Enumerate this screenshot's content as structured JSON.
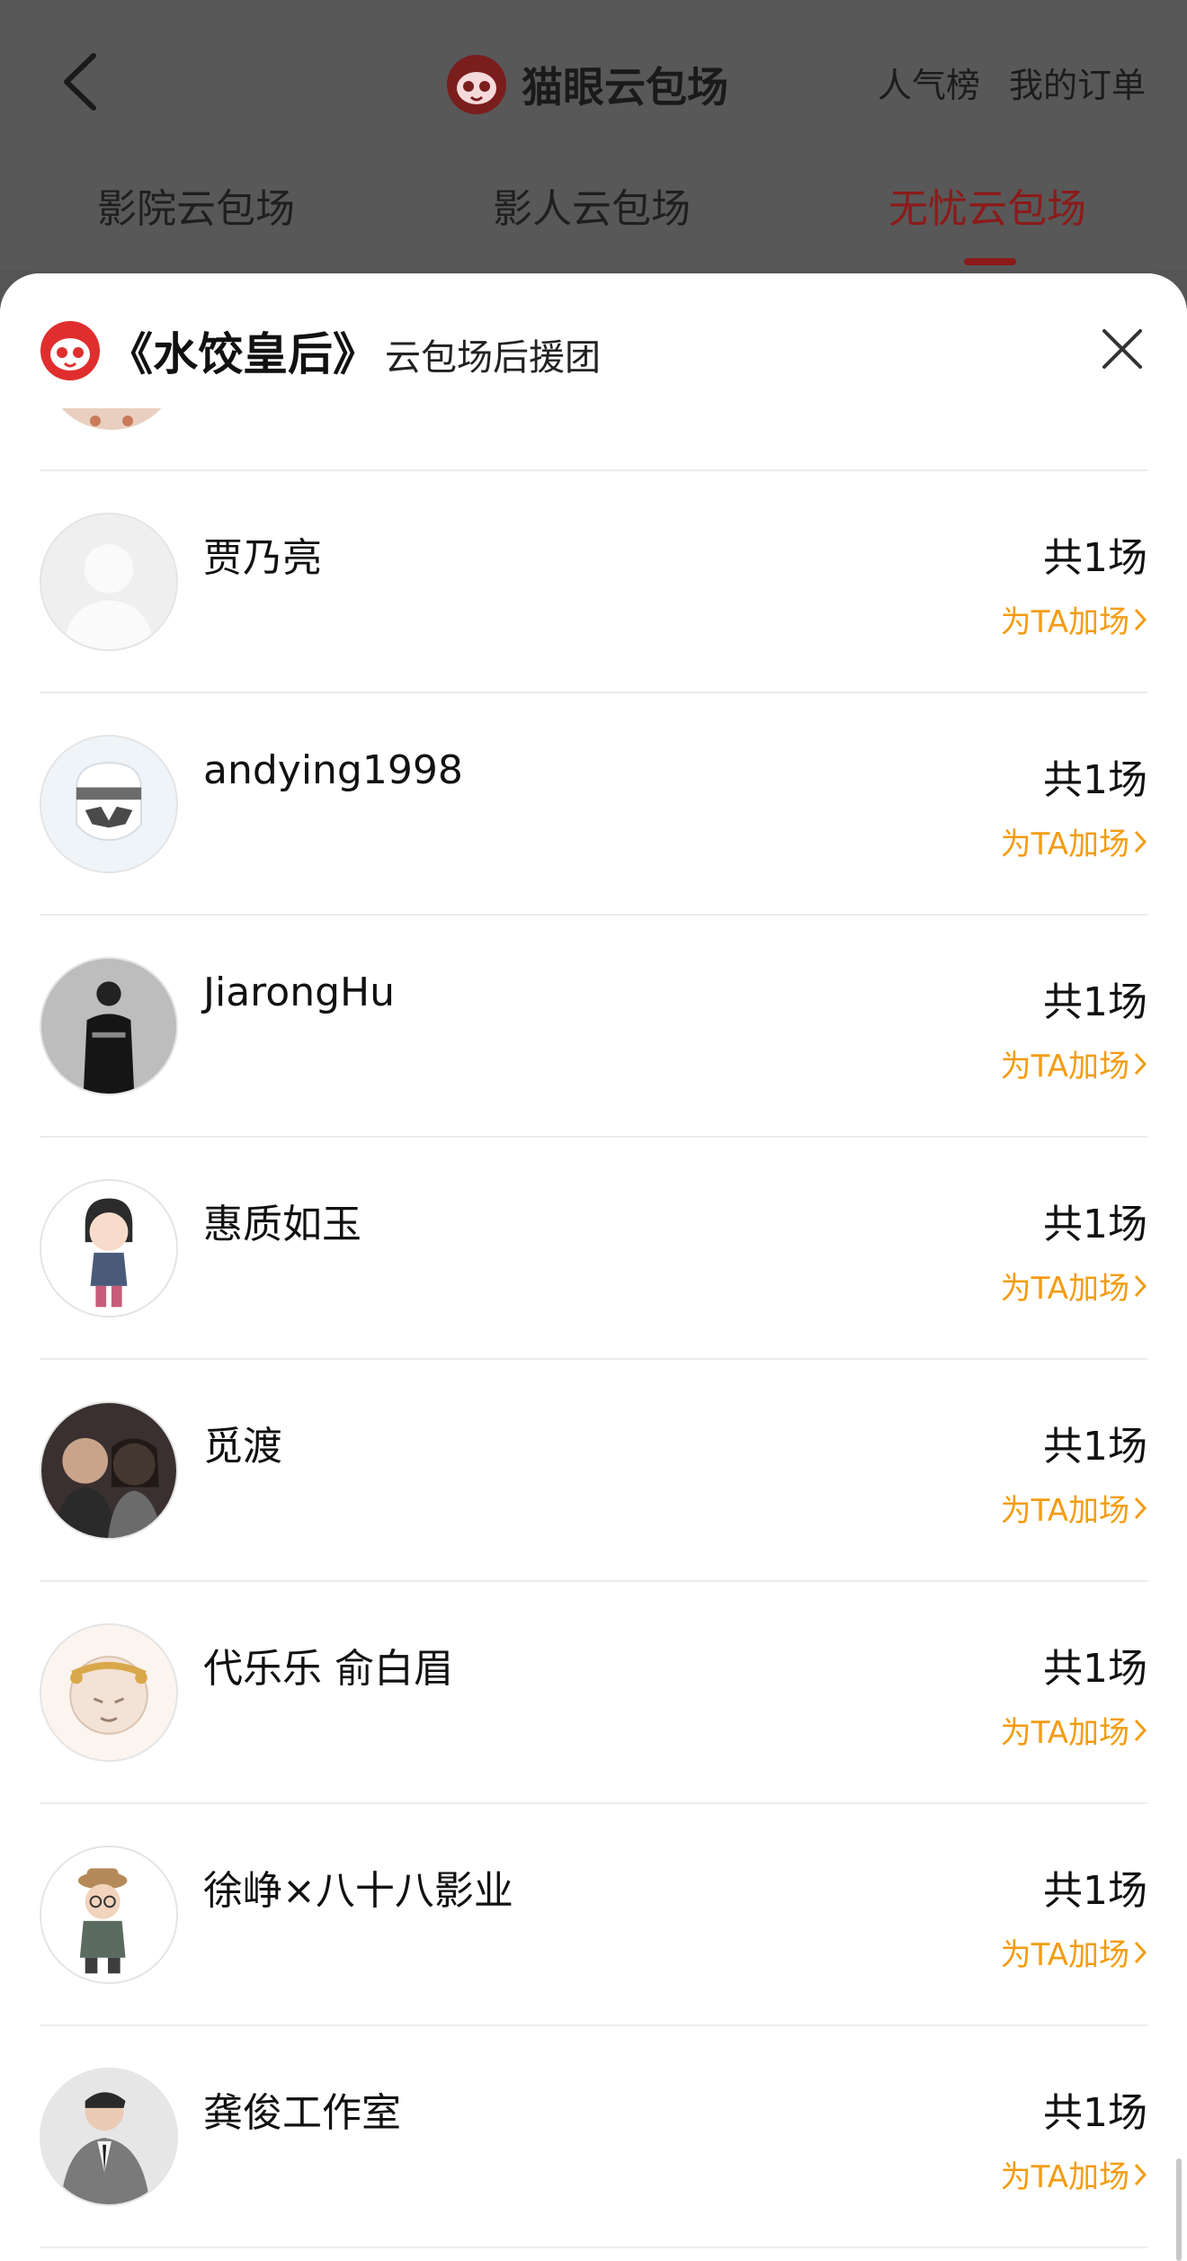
{
  "header": {
    "title": "猫眼云包场",
    "links": [
      "人气榜",
      "我的订单"
    ]
  },
  "tabs": [
    {
      "label": "影院云包场",
      "active": false
    },
    {
      "label": "影人云包场",
      "active": false
    },
    {
      "label": "无忧云包场",
      "active": true
    }
  ],
  "sheet": {
    "movie_title": "《水饺皇后》",
    "subtitle": "云包场后援团"
  },
  "supporters": [
    {
      "name": "贾乃亮",
      "count": "共1场",
      "action": "为TA加场",
      "avatar_icon": "default-person-avatar"
    },
    {
      "name": "andying1998",
      "count": "共1场",
      "action": "为TA加场",
      "avatar_icon": "stormtrooper-avatar"
    },
    {
      "name": "JiarongHu",
      "count": "共1场",
      "action": "为TA加场",
      "avatar_icon": "photo-avatar"
    },
    {
      "name": "惠质如玉",
      "count": "共1场",
      "action": "为TA加场",
      "avatar_icon": "cartoon-girl-avatar"
    },
    {
      "name": "觅渡",
      "count": "共1场",
      "action": "为TA加场",
      "avatar_icon": "photo-avatar"
    },
    {
      "name": "代乐乐 俞白眉",
      "count": "共1场",
      "action": "为TA加场",
      "avatar_icon": "monkey-king-avatar"
    },
    {
      "name": "徐峥×八十八影业",
      "count": "共1场",
      "action": "为TA加场",
      "avatar_icon": "cartoon-man-avatar"
    },
    {
      "name": "龚俊工作室",
      "count": "共1场",
      "action": "为TA加场",
      "avatar_icon": "photo-avatar"
    }
  ],
  "colors": {
    "accent_orange": "#f39c12",
    "brand_red": "#e02e2e",
    "active_tab": "#8c1a1a"
  }
}
